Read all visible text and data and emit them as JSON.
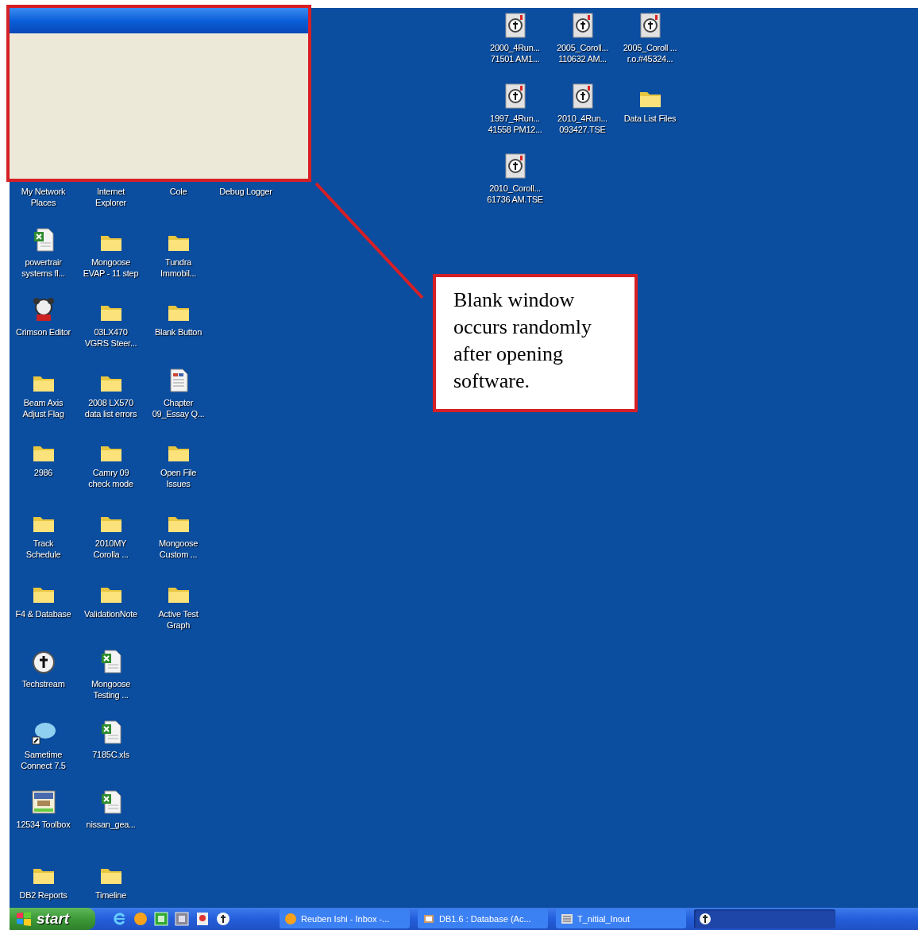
{
  "desktop_left": [
    [
      {
        "label": "My Network\nPlaces"
      },
      {
        "label": "Internet\nExplorer"
      },
      {
        "label": "Cole"
      },
      {
        "label": "Debug Logger"
      }
    ],
    [
      {
        "kind": "spreadsheet",
        "label": "powertrair\nsystems fl..."
      },
      {
        "kind": "folder",
        "label": "Mongoose\nEVAP - 11 step"
      },
      {
        "kind": "folder",
        "label": "Tundra\nImmobil..."
      }
    ],
    [
      {
        "kind": "editor",
        "label": "Crimson Editor"
      },
      {
        "kind": "folder",
        "label": "03LX470\nVGRS Steer..."
      },
      {
        "kind": "folder",
        "label": "Blank Button"
      }
    ],
    [
      {
        "kind": "folder",
        "label": "Beam Axis\nAdjust Flag"
      },
      {
        "kind": "folder",
        "label": "2008 LX570\ndata list errors"
      },
      {
        "kind": "document",
        "label": "Chapter\n09_Essay Q..."
      }
    ],
    [
      {
        "kind": "folder",
        "label": "2986"
      },
      {
        "kind": "folder",
        "label": "Camry 09\ncheck mode"
      },
      {
        "kind": "folder",
        "label": "Open File\nIssues"
      }
    ],
    [
      {
        "kind": "folder",
        "label": "Track\nSchedule"
      },
      {
        "kind": "folder",
        "label": "2010MY\nCorolla ..."
      },
      {
        "kind": "folder",
        "label": "Mongoose\nCustom ..."
      }
    ],
    [
      {
        "kind": "folder",
        "label": "F4 & Database"
      },
      {
        "kind": "folder",
        "label": "ValidationNote"
      },
      {
        "kind": "folder",
        "label": "Active Test\nGraph"
      }
    ],
    [
      {
        "kind": "app",
        "label": "Techstream"
      },
      {
        "kind": "spreadsheet",
        "label": "Mongoose\nTesting ..."
      }
    ],
    [
      {
        "kind": "chat",
        "label": "Sametime\nConnect 7.5"
      },
      {
        "kind": "spreadsheet",
        "label": "7185C.xls"
      }
    ],
    [
      {
        "kind": "toolbox",
        "label": "12534 Toolbox"
      },
      {
        "kind": "spreadsheet",
        "label": "nissan_gea..."
      }
    ],
    [
      {
        "kind": "folder",
        "label": "DB2 Reports"
      },
      {
        "kind": "folder",
        "label": "Timeline"
      }
    ]
  ],
  "desktop_right": [
    [
      {
        "kind": "tse",
        "label": "2000_4Run...\n71501 AM1..."
      },
      {
        "kind": "tse",
        "label": "2005_Coroll...\n110632 AM..."
      },
      {
        "kind": "tse",
        "label": "2005_Coroll ...\nr.o.#45324..."
      }
    ],
    [
      {
        "kind": "tse",
        "label": "1997_4Run...\n41558 PM12..."
      },
      {
        "kind": "tse",
        "label": "2010_4Run...\n093427.TSE"
      },
      {
        "kind": "folder",
        "label": "Data List Files"
      }
    ],
    [
      {
        "kind": "tse",
        "label": "2010_Coroll...\n61736 AM.TSE"
      }
    ]
  ],
  "callout": {
    "text": "Blank window occurs randomly after opening software."
  },
  "taskbar": {
    "start": "start",
    "tasks": [
      {
        "kind": "mail",
        "label": "Reuben Ishi - Inbox -...",
        "selected": false
      },
      {
        "kind": "database",
        "label": "DB1.6 : Database (Ac...",
        "selected": false
      },
      {
        "kind": "form",
        "label": "T_nitial_Inout",
        "selected": false
      },
      {
        "kind": "app",
        "selected": true
      }
    ]
  }
}
